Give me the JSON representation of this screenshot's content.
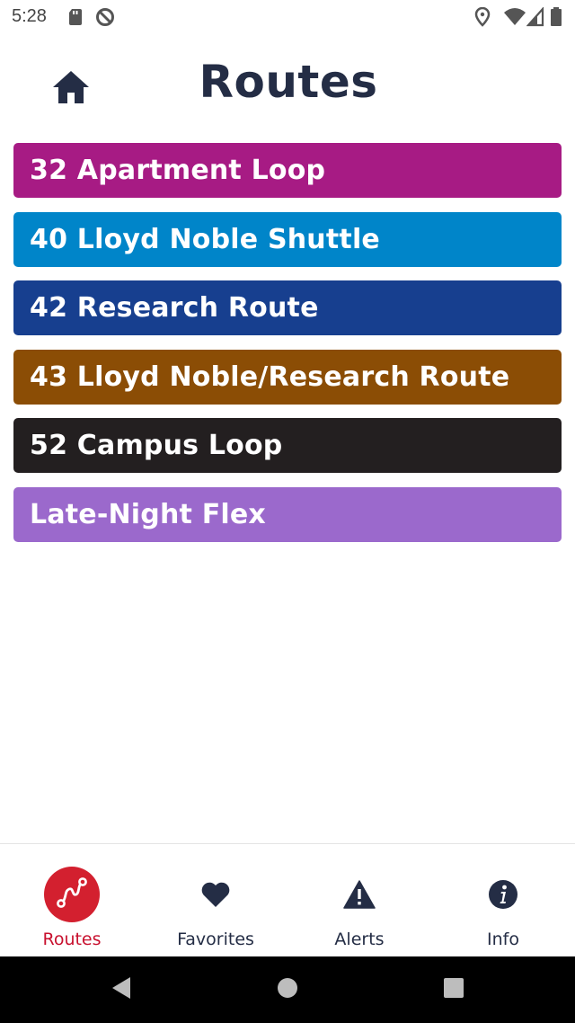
{
  "status_bar": {
    "time": "5:28",
    "icons": [
      "sd-card-icon",
      "do-not-disturb-icon",
      "location-icon",
      "wifi-icon",
      "signal-icon",
      "battery-icon"
    ]
  },
  "header": {
    "title": "Routes",
    "home_icon": "home-icon"
  },
  "routes": [
    {
      "label": "32 Apartment Loop",
      "color": "#a71b84"
    },
    {
      "label": "40 Lloyd Noble Shuttle",
      "color": "#0085c9"
    },
    {
      "label": "42 Research Route",
      "color": "#173f8f"
    },
    {
      "label": "43 Lloyd Noble/Research Route",
      "color": "#8b4d05"
    },
    {
      "label": "52 Campus Loop",
      "color": "#231f20"
    },
    {
      "label": "Late-Night Flex",
      "color": "#9b69cc"
    }
  ],
  "bottom_nav": {
    "items": [
      {
        "label": "Routes",
        "icon": "route-icon",
        "active": true
      },
      {
        "label": "Favorites",
        "icon": "heart-icon",
        "active": false
      },
      {
        "label": "Alerts",
        "icon": "alert-icon",
        "active": false
      },
      {
        "label": "Info",
        "icon": "info-icon",
        "active": false
      }
    ],
    "active_color": "#d3202f"
  },
  "system_nav": {
    "buttons": [
      "back-icon",
      "home-circle-icon",
      "recents-icon"
    ]
  }
}
